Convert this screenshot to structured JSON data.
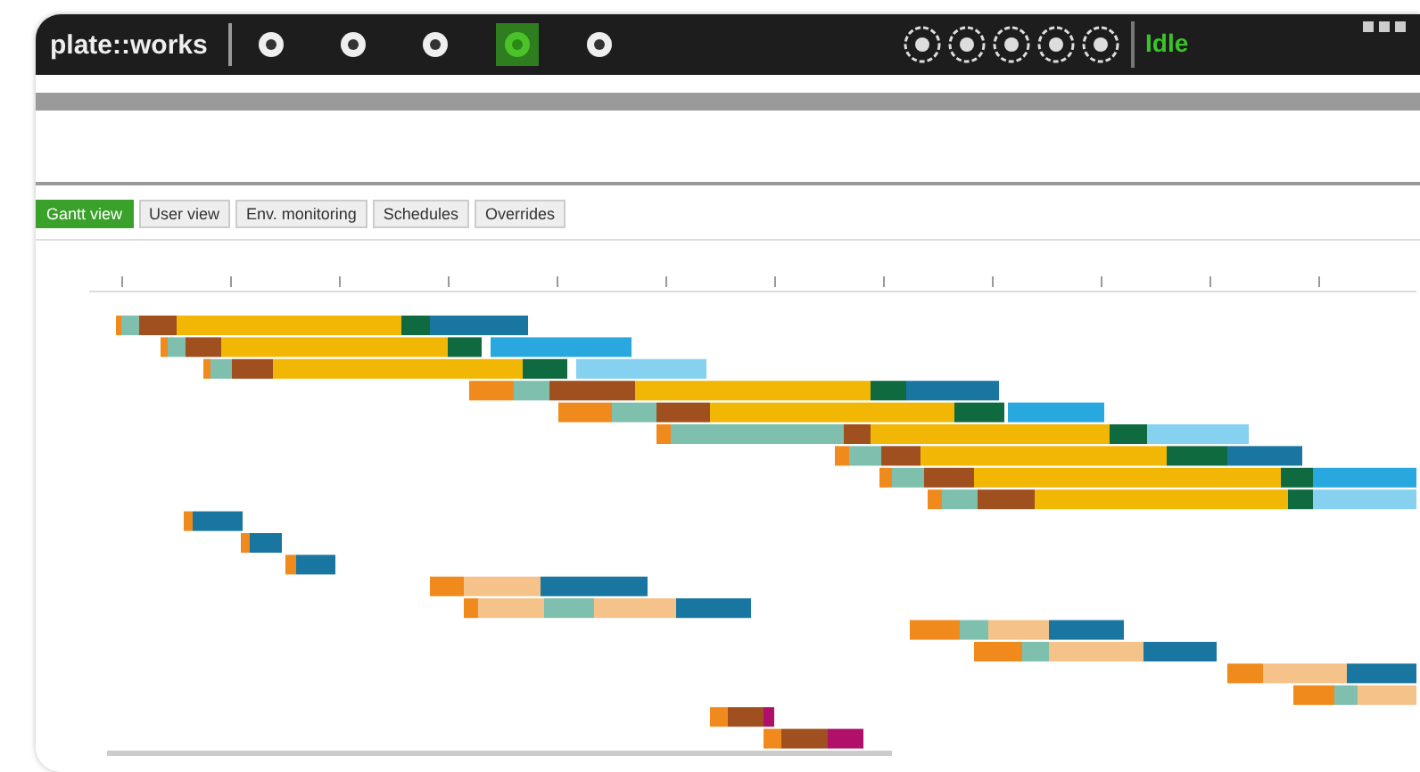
{
  "app": {
    "logo": "plate::works"
  },
  "toolbar": [
    {
      "selected": false
    },
    {
      "selected": false
    },
    {
      "selected": false
    },
    {
      "selected": true
    },
    {
      "selected": false
    }
  ],
  "status": {
    "state": "Idle"
  },
  "tabs": [
    {
      "label": "Gantt view",
      "selected": true
    },
    {
      "label": "User view",
      "selected": false
    },
    {
      "label": "Env. monitoring",
      "selected": false
    },
    {
      "label": "Schedules",
      "selected": false
    },
    {
      "label": "Overrides",
      "selected": false
    }
  ]
}
